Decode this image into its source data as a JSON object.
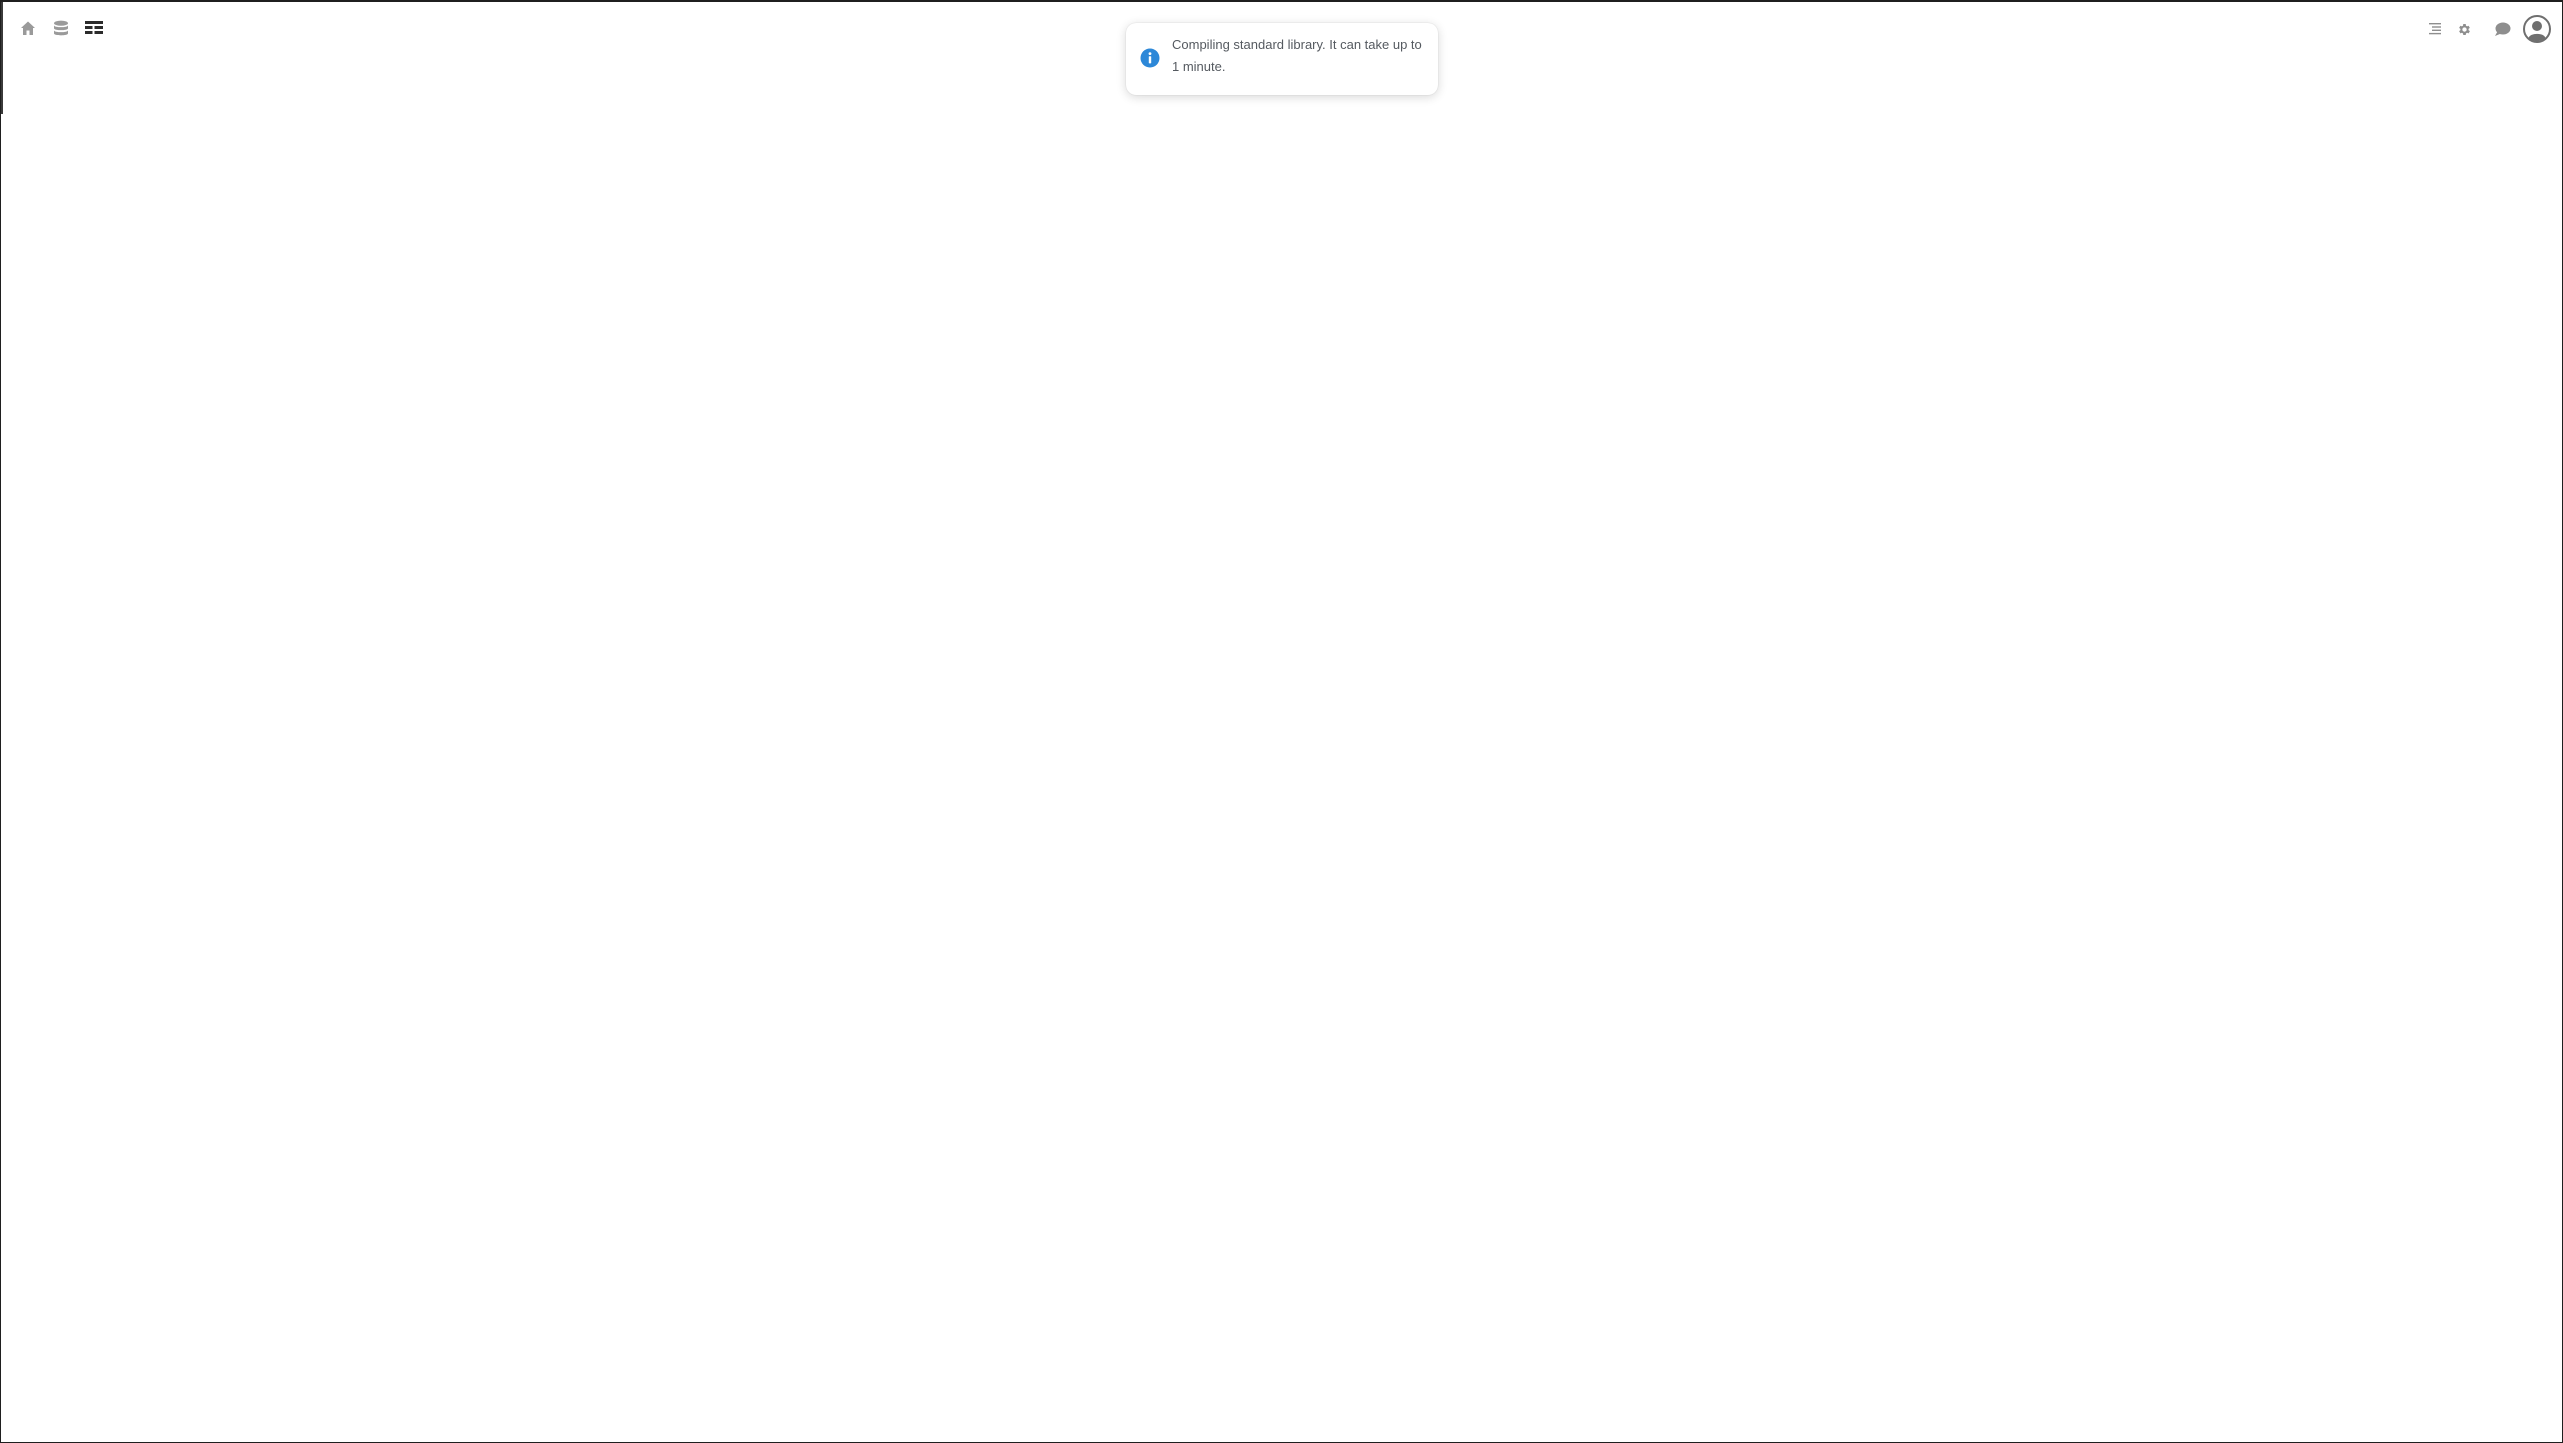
{
  "toolbar": {
    "left_icons": [
      "home-icon",
      "database-icon",
      "table-icon"
    ],
    "right_icons": [
      "outline-icon",
      "settings-gear-icon",
      "chat-bubble-icon",
      "user-avatar-icon"
    ]
  },
  "toast": {
    "icon": "info-icon",
    "icon_color": "#2d88d8",
    "message": "Compiling standard library. It can take up to 1 minute."
  }
}
